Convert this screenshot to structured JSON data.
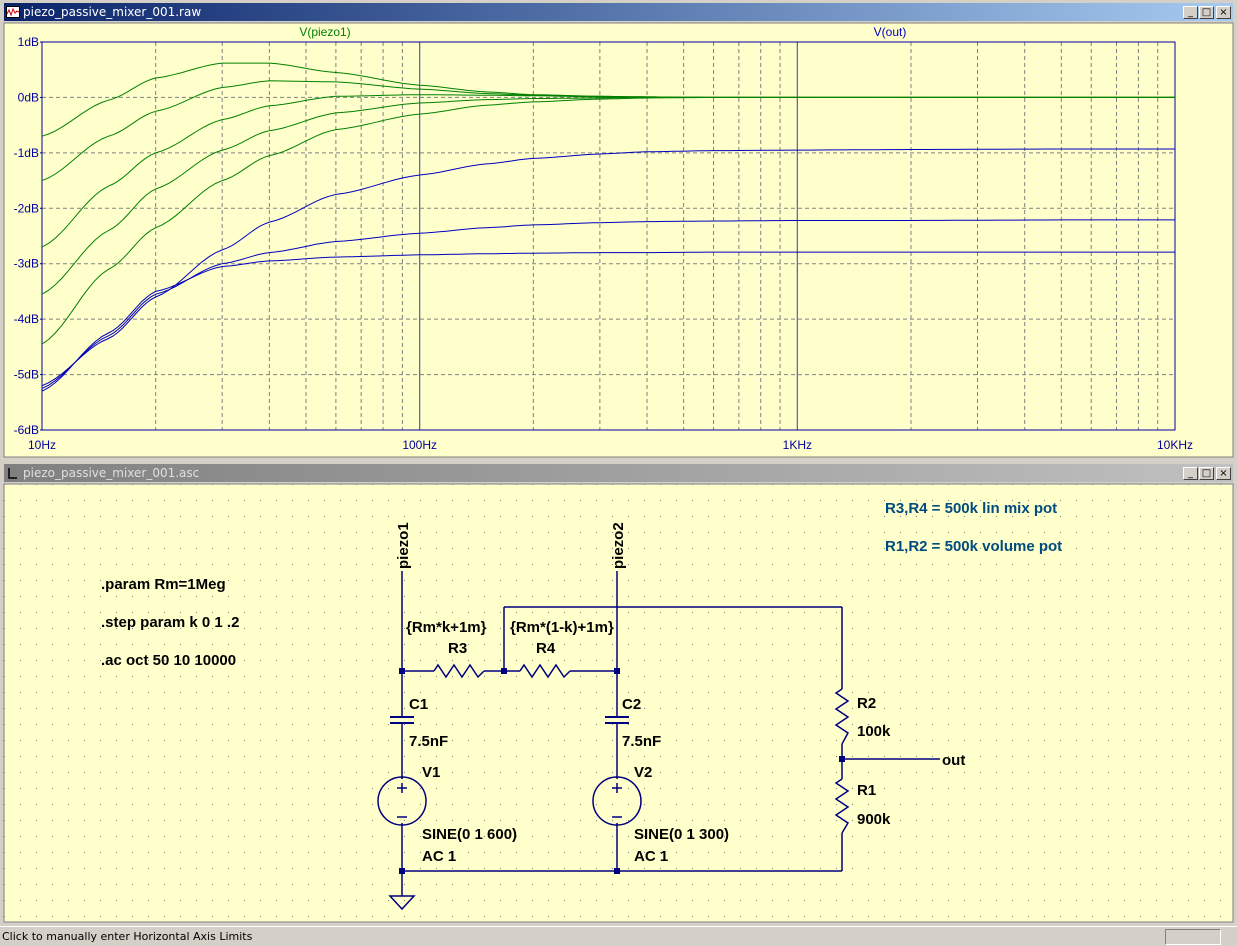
{
  "waveform_window": {
    "title": "piezo_passive_mixer_001.raw",
    "trace_labels": [
      "V(piezo1)",
      "V(out)"
    ],
    "trace_colors": [
      "#008000",
      "#0000c0"
    ]
  },
  "schematic_window": {
    "title": "piezo_passive_mixer_001.asc",
    "directives": [
      ".param Rm=1Meg",
      ".step param k 0 1 .2",
      ".ac oct 50 10 10000"
    ],
    "comments": [
      "R3,R4 = 500k lin mix pot",
      "R1,R2 = 500k volume pot"
    ],
    "net_labels": {
      "piezo1": "piezo1",
      "piezo2": "piezo2",
      "out": "out"
    },
    "components": {
      "R3": {
        "name": "R3",
        "value": "{Rm*k+1m}"
      },
      "R4": {
        "name": "R4",
        "value": "{Rm*(1-k)+1m}"
      },
      "C1": {
        "name": "C1",
        "value": "7.5nF"
      },
      "C2": {
        "name": "C2",
        "value": "7.5nF"
      },
      "V1": {
        "name": "V1",
        "value": "SINE(0 1 600)",
        "ac": "AC 1"
      },
      "V2": {
        "name": "V2",
        "value": "SINE(0 1 300)",
        "ac": "AC 1"
      },
      "R2": {
        "name": "R2",
        "value": "100k"
      },
      "R1": {
        "name": "R1",
        "value": "900k"
      }
    }
  },
  "status_bar": {
    "text": "Click to manually enter Horizontal Axis Limits"
  },
  "window_buttons": {
    "minimize": "_",
    "maximize": "□",
    "close": "×"
  },
  "chart_data": {
    "type": "line",
    "x_scale": "log",
    "xlim": [
      10,
      10000
    ],
    "ylim": [
      -6,
      1
    ],
    "x_ticks": [
      "10Hz",
      "100Hz",
      "1KHz",
      "10KHz"
    ],
    "y_ticks": [
      "1dB",
      "0dB",
      "-1dB",
      "-2dB",
      "-3dB",
      "-4dB",
      "-5dB",
      "-6dB"
    ],
    "grid": true,
    "x": [
      10,
      15,
      20,
      30,
      40,
      60,
      100,
      150,
      200,
      300,
      400,
      600,
      1000,
      2000,
      5000,
      10000
    ],
    "series": [
      {
        "name": "V(piezo1)",
        "values": [
          -0.7,
          -0.05,
          0.35,
          0.62,
          0.62,
          0.45,
          0.22,
          0.1,
          0.05,
          0.02,
          0.01,
          0.0,
          0.0,
          0.0,
          0.0,
          0.0
        ]
      },
      {
        "name": "V(piezo1)",
        "values": [
          -1.5,
          -0.7,
          -0.25,
          0.18,
          0.3,
          0.28,
          0.15,
          0.07,
          0.04,
          0.02,
          0.01,
          0.0,
          0.0,
          0.0,
          0.0,
          0.0
        ]
      },
      {
        "name": "V(piezo1)",
        "values": [
          -2.7,
          -1.6,
          -1.0,
          -0.4,
          -0.15,
          0.02,
          0.05,
          0.04,
          0.03,
          0.01,
          0.0,
          0.0,
          0.0,
          0.0,
          0.0,
          0.0
        ]
      },
      {
        "name": "V(piezo1)",
        "values": [
          -3.55,
          -2.4,
          -1.65,
          -0.95,
          -0.6,
          -0.28,
          -0.1,
          -0.04,
          -0.02,
          -0.01,
          0.0,
          0.0,
          0.0,
          0.0,
          0.0,
          0.0
        ]
      },
      {
        "name": "V(piezo1)",
        "values": [
          -4.45,
          -3.1,
          -2.35,
          -1.5,
          -1.05,
          -0.58,
          -0.3,
          -0.14,
          -0.08,
          -0.03,
          -0.01,
          0.0,
          0.0,
          0.0,
          0.0,
          0.0
        ]
      },
      {
        "name": "V(out)",
        "values": [
          -5.2,
          -4.35,
          -3.6,
          -2.75,
          -2.25,
          -1.75,
          -1.4,
          -1.2,
          -1.1,
          -1.02,
          -0.98,
          -0.96,
          -0.95,
          -0.94,
          -0.93,
          -0.93
        ]
      },
      {
        "name": "V(out)",
        "values": [
          -5.25,
          -4.3,
          -3.55,
          -3.0,
          -2.8,
          -2.6,
          -2.45,
          -2.35,
          -2.3,
          -2.26,
          -2.24,
          -2.23,
          -2.22,
          -2.22,
          -2.21,
          -2.21
        ]
      },
      {
        "name": "V(out)",
        "values": [
          -5.3,
          -4.25,
          -3.5,
          -3.05,
          -2.95,
          -2.88,
          -2.84,
          -2.82,
          -2.81,
          -2.8,
          -2.8,
          -2.79,
          -2.79,
          -2.79,
          -2.79,
          -2.79
        ]
      }
    ]
  }
}
